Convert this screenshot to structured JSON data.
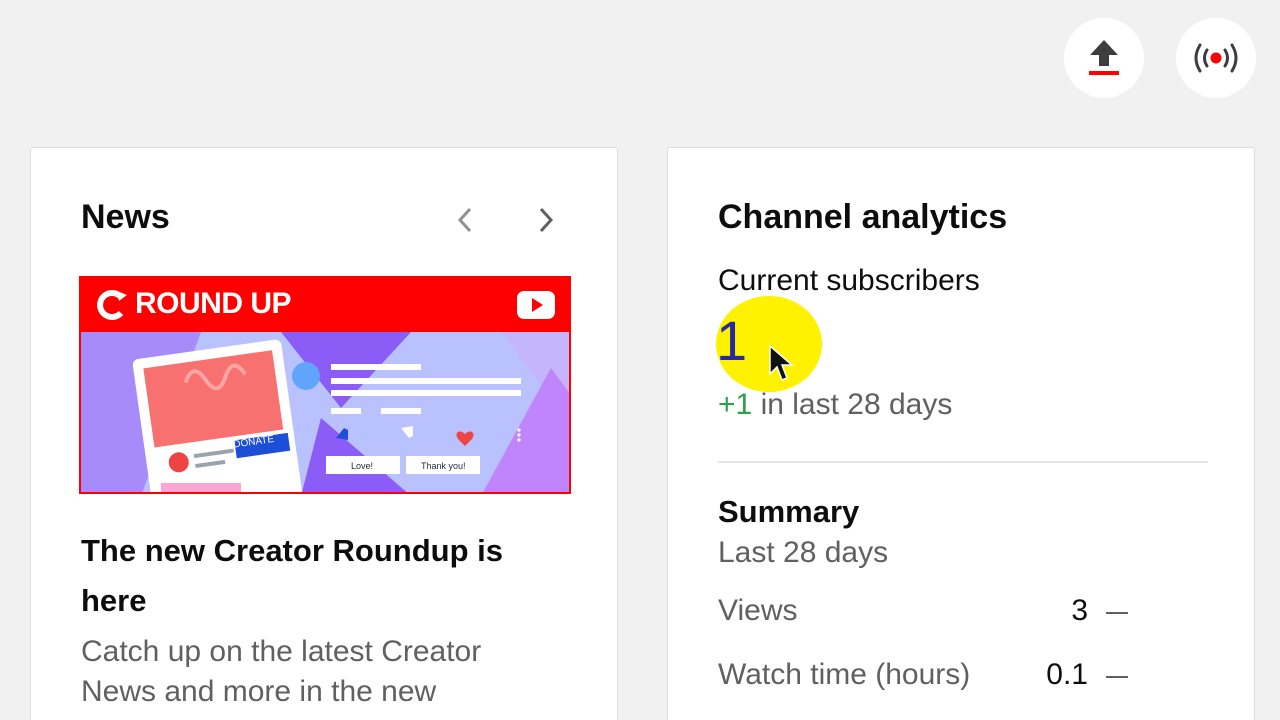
{
  "header": {
    "upload_icon": "upload-icon",
    "live_icon": "live-broadcast-icon"
  },
  "news": {
    "title": "News",
    "thumbnail": {
      "banner_text": "ROUND UP",
      "donate_label": "DONATE",
      "love_label": "Love!",
      "thanks_label": "Thank you!"
    },
    "article_title": "The new Creator Roundup is here",
    "article_desc": "Catch up on the latest Creator News and more in the new"
  },
  "analytics": {
    "title": "Channel analytics",
    "subscribers_label": "Current subscribers",
    "subscribers_count": "1",
    "change_value": "+1",
    "change_text": "in last 28 days",
    "summary_title": "Summary",
    "summary_period": "Last 28 days",
    "metrics": [
      {
        "label": "Views",
        "value": "3"
      },
      {
        "label": "Watch time (hours)",
        "value": "0.1"
      }
    ]
  },
  "colors": {
    "accent_red": "#ff0000",
    "positive_green": "#2e9e4f",
    "highlight_yellow": "#fff200"
  }
}
